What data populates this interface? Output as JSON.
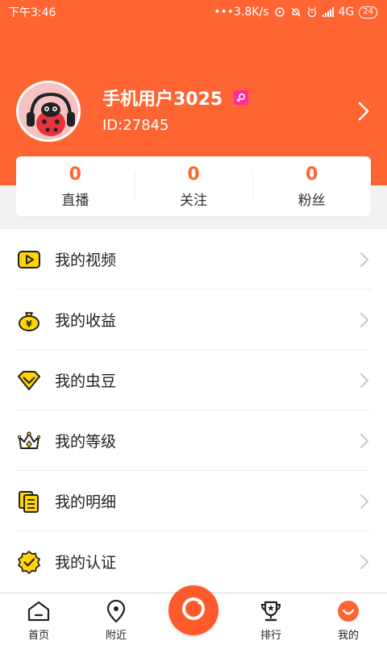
{
  "status_bar": {
    "time": "下午3:46",
    "network_speed": "•••3.8K/s",
    "network_type": "4G",
    "battery": "24"
  },
  "profile": {
    "username": "手机用户3025",
    "user_id": "ID:27845",
    "gender_icon": "female-icon"
  },
  "stats": [
    {
      "value": "0",
      "label": "直播"
    },
    {
      "value": "0",
      "label": "关注"
    },
    {
      "value": "0",
      "label": "粉丝"
    }
  ],
  "menu": [
    {
      "label": "我的视频",
      "icon": "video-icon"
    },
    {
      "label": "我的收益",
      "icon": "money-bag-icon"
    },
    {
      "label": "我的虫豆",
      "icon": "diamond-icon"
    },
    {
      "label": "我的等级",
      "icon": "crown-icon"
    },
    {
      "label": "我的明细",
      "icon": "document-list-icon"
    },
    {
      "label": "我的认证",
      "icon": "verified-badge-icon"
    }
  ],
  "tabbar": [
    {
      "label": "首页",
      "icon": "home-icon"
    },
    {
      "label": "附近",
      "icon": "location-pin-icon"
    },
    {
      "label": "",
      "icon": "live-camera-icon"
    },
    {
      "label": "排行",
      "icon": "trophy-icon"
    },
    {
      "label": "我的",
      "icon": "profile-face-icon"
    }
  ],
  "colors": {
    "brand": "#ff6533",
    "icon_yellow": "#ffd400",
    "gender_pink": "#ff2d9a"
  }
}
